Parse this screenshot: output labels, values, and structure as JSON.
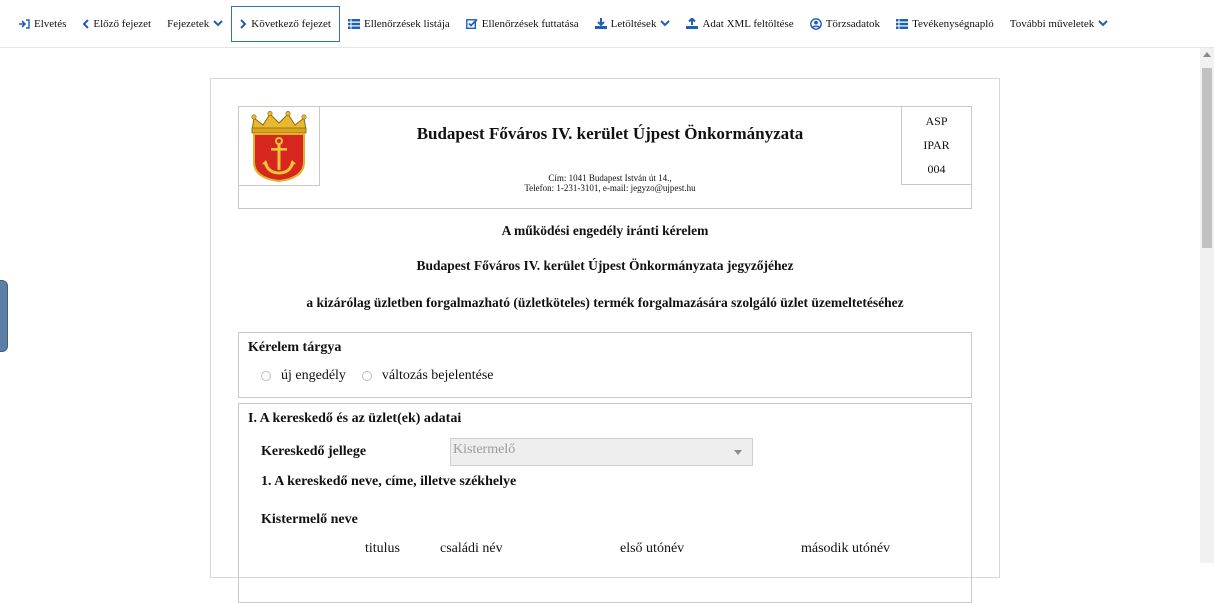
{
  "toolbar": {
    "items": [
      {
        "label": "Elvetés",
        "icon": "sign-out-icon"
      },
      {
        "label": "Előző fejezet",
        "icon": "chevron-left-icon"
      },
      {
        "label": "Fejezetek",
        "icon": "",
        "dropdown": true
      },
      {
        "label": "Következő fejezet",
        "icon": "chevron-right-icon",
        "active": true
      },
      {
        "label": "Ellenőrzések listája",
        "icon": "list-icon"
      },
      {
        "label": "Ellenőrzések futtatása",
        "icon": "check-square-icon"
      },
      {
        "label": "Letöltések",
        "icon": "download-icon",
        "dropdown": true
      },
      {
        "label": "Adat XML feltöltése",
        "icon": "upload-icon"
      },
      {
        "label": "Törzsadatok",
        "icon": "user-circle-icon"
      },
      {
        "label": "Tevékenységnapló",
        "icon": "list-icon"
      },
      {
        "label": "További műveletek",
        "icon": "",
        "dropdown": true
      }
    ],
    "accent_color": "#1f5fb8"
  },
  "header": {
    "org_name": "Budapest Főváros IV. kerület Újpest Önkormányzata",
    "address_line1": "Cím: 1041 Budapest István út 14.,",
    "address_line2": "Telefon: 1-231-3101, e-mail: jegyzo@ujpest.hu",
    "codes": [
      "ASP",
      "IPAR",
      "004"
    ]
  },
  "titles": {
    "line1": "A működési engedély iránti kérelem",
    "line2": "Budapest Főváros IV. kerület Újpest Önkormányzata jegyzőjéhez",
    "line3": "a kizárólag üzletben forgalmazható (üzletköteles) termék forgalmazására szolgáló üzlet üzemeltetéséhez"
  },
  "request_subject": {
    "heading": "Kérelem tárgya",
    "options": [
      "új engedély",
      "változás bejelentése"
    ]
  },
  "section1": {
    "heading": "I. A kereskedő és az üzlet(ek) adatai",
    "merchant_type_label": "Kereskedő jellege",
    "merchant_type_value": "Kistermelő",
    "sub_heading": "1. A kereskedő neve, címe, illetve székhelye",
    "name_label": "Kistermelő neve",
    "columns": [
      "titulus",
      "családi név",
      "első utónév",
      "második utónév"
    ]
  }
}
